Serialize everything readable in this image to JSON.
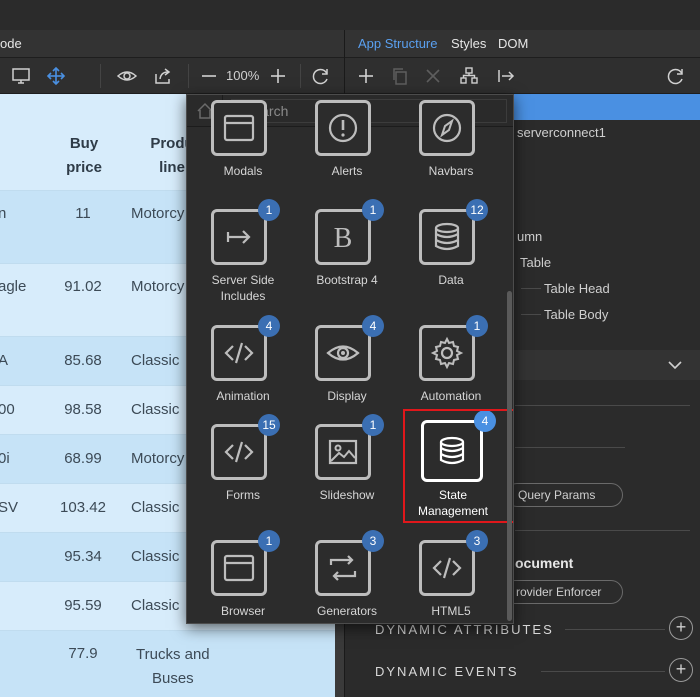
{
  "left_panel": {
    "tab_label": "ode",
    "zoom_label": "100%",
    "table": {
      "headers": [
        {
          "line1": "Buy",
          "line2": "price"
        },
        {
          "line1": "Produ",
          "line2": "line"
        }
      ],
      "rows": [
        {
          "name": "n",
          "price": "11",
          "line": "Motorcy"
        },
        {
          "name": "agle",
          "price": "91.02",
          "line": "Motorcy"
        },
        {
          "name": "A",
          "price": "85.68",
          "line": "Classic"
        },
        {
          "name": "00",
          "price": "98.58",
          "line": "Classic"
        },
        {
          "name": "0i",
          "price": "68.99",
          "line": "Motorcy"
        },
        {
          "name": "SV",
          "price": "103.42",
          "line": "Classic"
        },
        {
          "name": "",
          "price": "95.34",
          "line": "Classic"
        },
        {
          "name": "",
          "price": "95.59",
          "line": "Classic"
        },
        {
          "name": "",
          "price": "77.9",
          "line": "Trucks and",
          "line2": "Buses"
        }
      ]
    }
  },
  "right_panel": {
    "tabs": [
      "App Structure",
      "Styles",
      "DOM"
    ],
    "tree": {
      "serverconnect": "serverconnect1",
      "column": "umn",
      "table": "Table",
      "table_head": "Table Head",
      "table_body": "Table Body"
    },
    "query_params_label": "Query Params",
    "document_heading": "ocument",
    "provider_enforcer_label": "rovider Enforcer",
    "dynamic_attributes_label": "DYNAMIC ATTRIBUTES",
    "dynamic_events_label": "DYNAMIC EVENTS"
  },
  "popup": {
    "search_placeholder": "Search",
    "items": [
      {
        "label": "Modals",
        "icon": "window-icon",
        "badge": ""
      },
      {
        "label": "Alerts",
        "icon": "alert-icon",
        "badge": ""
      },
      {
        "label": "Navbars",
        "icon": "compass-icon",
        "badge": ""
      },
      {
        "label": "Server Side Includes",
        "icon": "arrow-right-icon",
        "badge": "1"
      },
      {
        "label": "Bootstrap 4",
        "icon": "bootstrap-icon",
        "badge": "1"
      },
      {
        "label": "Data",
        "icon": "database-icon",
        "badge": "12"
      },
      {
        "label": "Animation",
        "icon": "code-icon",
        "badge": "4"
      },
      {
        "label": "Display",
        "icon": "eye-icon",
        "badge": "4"
      },
      {
        "label": "Automation",
        "icon": "gear-icon",
        "badge": "1"
      },
      {
        "label": "Forms",
        "icon": "code-icon",
        "badge": "15"
      },
      {
        "label": "Slideshow",
        "icon": "image-icon",
        "badge": "1"
      },
      {
        "label": "State Management",
        "icon": "database-icon",
        "badge": "4",
        "selected": true
      },
      {
        "label": "Browser",
        "icon": "window-icon",
        "badge": "1"
      },
      {
        "label": "Generators",
        "icon": "repeat-icon",
        "badge": "3"
      },
      {
        "label": "HTML5",
        "icon": "code-icon",
        "badge": "3"
      }
    ]
  },
  "colors": {
    "accent": "#4a90e2",
    "badge": "#3b6fb3",
    "selection_outline": "#e0171b",
    "table_bg": "#d7ecfb"
  }
}
